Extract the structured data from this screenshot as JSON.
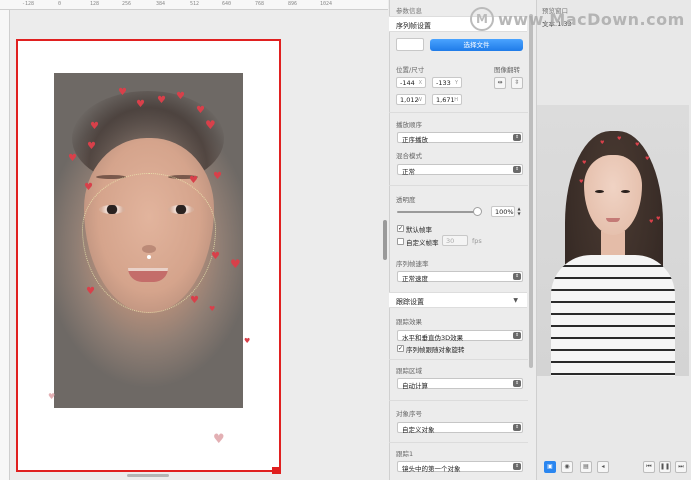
{
  "ruler": {
    "labels": [
      "-128",
      "0",
      "128",
      "256",
      "384",
      "512",
      "640",
      "768",
      "896",
      "1024"
    ]
  },
  "canvas": {
    "icons": [
      "heart-sticker",
      "face-mesh-dots"
    ]
  },
  "panel": {
    "section_param_info": "参数信息",
    "section_sequence": "序列帧设置",
    "choose_file_label": "选择文件",
    "position_size_label": "位置/尺寸",
    "flip_label": "图像翻转",
    "x": {
      "value": "-144",
      "unit": "X"
    },
    "y": {
      "value": "-133",
      "unit": "Y"
    },
    "w": {
      "value": "1,012",
      "unit": "W"
    },
    "h": {
      "value": "1,671",
      "unit": "H"
    },
    "play_order_label": "播放顺序",
    "play_order_value": "正序播放",
    "blend_mode_label": "混合模式",
    "blend_mode_value": "正常",
    "opacity_label": "透明度",
    "opacity_value": "100%",
    "opacity_fraction": 1.0,
    "default_fps_label": "默认帧率",
    "custom_fps_label": "自定义帧率",
    "custom_fps_value": "30",
    "fps_unit": "fps",
    "seq_speed_label": "序列帧速率",
    "seq_speed_value": "正常速度",
    "section_tracking": "跟踪设置",
    "tracking_effect_label": "跟踪效果",
    "tracking_effect_value": "水平和垂直伪3D效果",
    "rotate_with_object_label": "序列帧跟随对象旋转",
    "tracking_area_label": "跟踪区域",
    "tracking_area_value": "自动计算",
    "object_index_label": "对象序号",
    "object_index_value": "自定义对象",
    "tracking1_label": "跟踪1",
    "tracking1_value": "镜头中的第一个对象"
  },
  "preview": {
    "title": "预览窗口",
    "subtitle_partial": "文本.1.33",
    "watermark": "www.MacDown.com",
    "watermark_logo": "M"
  }
}
